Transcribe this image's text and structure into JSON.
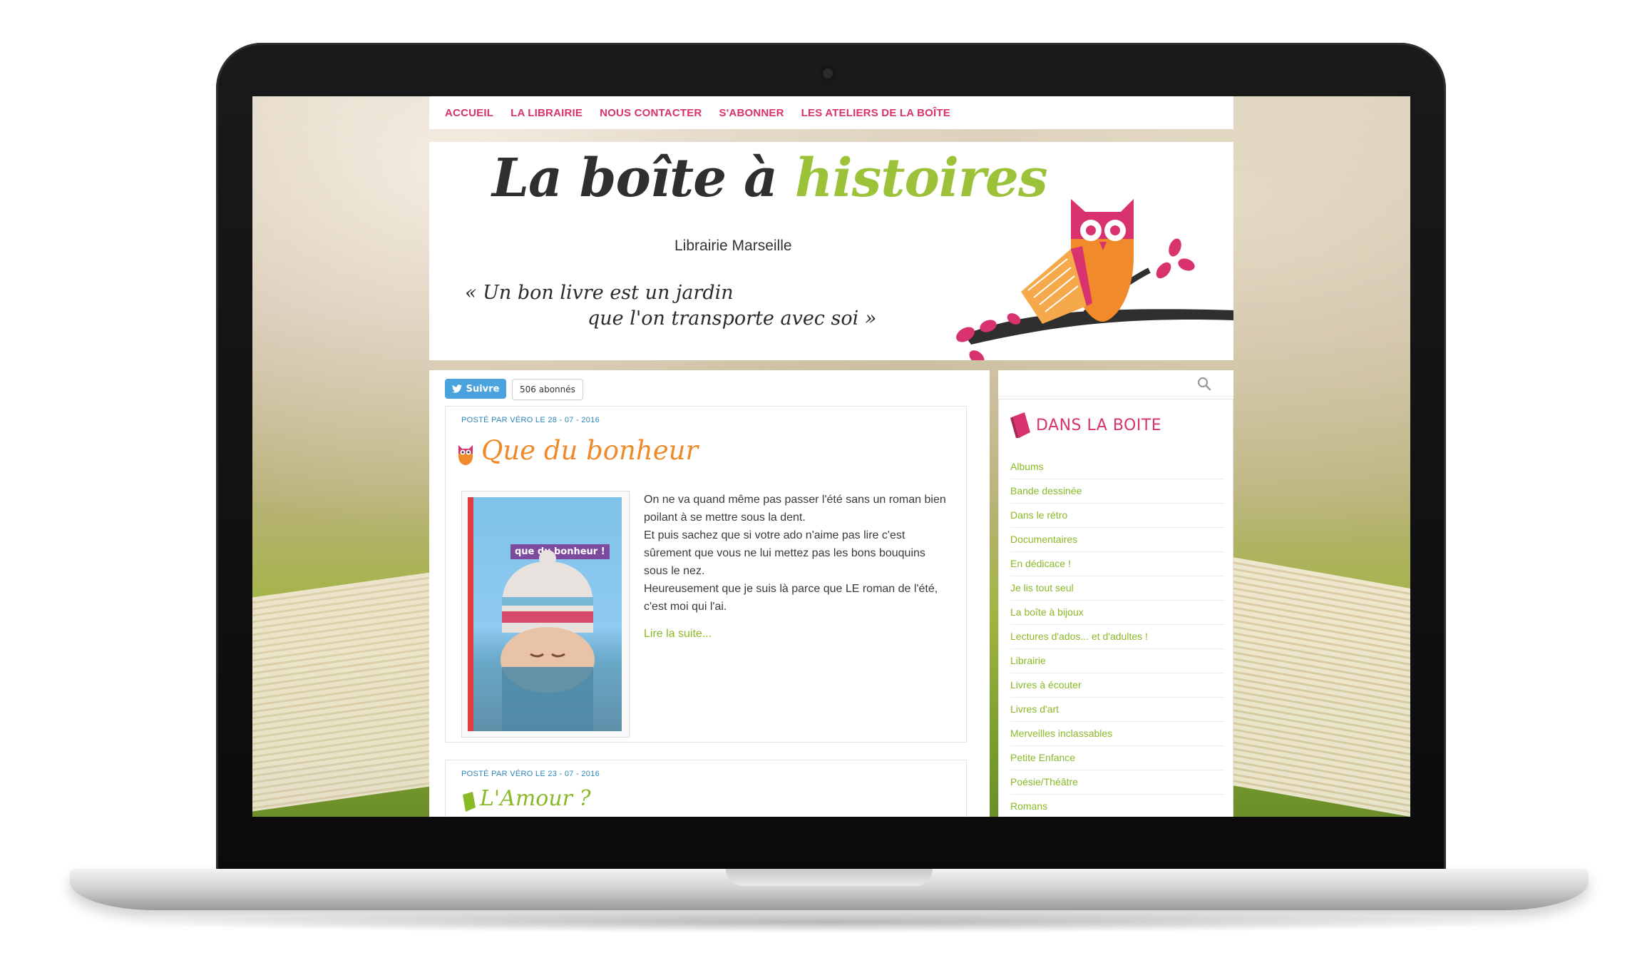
{
  "nav": {
    "items": [
      "ACCUEIL",
      "LA LIBRAIRIE",
      "NOUS CONTACTER",
      "S'ABONNER",
      "LES ATELIERS DE LA BOÎTE"
    ]
  },
  "header": {
    "title_main": "La boîte à ",
    "title_accent": "histoires",
    "subtitle": "Librairie Marseille",
    "quote_line1": "« Un bon livre est un jardin",
    "quote_line2": "que l'on transporte avec soi »"
  },
  "twitter": {
    "follow_label": "Suivre",
    "followers": "506 abonnés"
  },
  "posts": [
    {
      "meta": "POSTÉ PAR VÉRO LE 28 - 07 - 2016",
      "title": "Que du bonheur",
      "cover_text": "que du bonheur !",
      "paragraph1": "On ne va quand même pas passer l'été sans un roman bien poilant à se mettre sous la dent.",
      "paragraph2": "Et puis sachez que si votre ado n'aime pas lire c'est sûrement que vous ne lui mettez pas les bons bouquins sous le nez.",
      "paragraph3": "Heureusement que je suis là parce que LE roman de l'été, c'est moi qui l'ai.",
      "read_more": "Lire la suite..."
    },
    {
      "meta": "POSTÉ PAR VÉRO LE 23 - 07 - 2016",
      "title": "L'Amour ?"
    }
  ],
  "sidebar": {
    "heading": "DANS LA BOITE",
    "categories": [
      "Albums",
      "Bande dessinée",
      "Dans le rétro",
      "Documentaires",
      "En dédicace !",
      "Je lis tout seul",
      "La boîte à bijoux",
      "Lectures d'ados... et d'adultes !",
      "Librairie",
      "Livres à écouter",
      "Livres d'art",
      "Merveilles inclassables",
      "Petite Enfance",
      "Poésie/Théâtre",
      "Romans"
    ]
  },
  "colors": {
    "accent_pink": "#d8336e",
    "accent_green": "#9cc23a",
    "accent_orange": "#ef8a2a",
    "link_blue": "#2d86b8"
  },
  "icons": [
    "twitter-bird-icon",
    "search-icon",
    "owl-icon",
    "book-icon"
  ]
}
